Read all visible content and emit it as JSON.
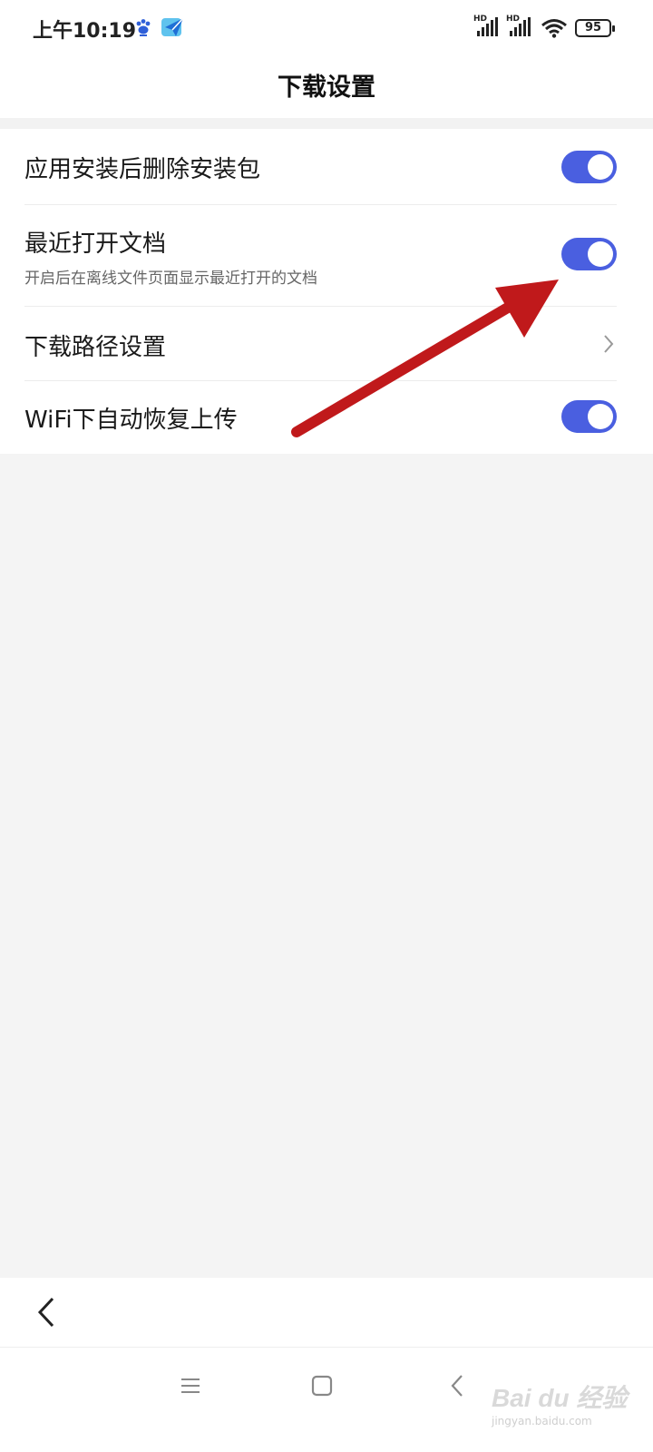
{
  "status_bar": {
    "time": "上午10:19",
    "signal_1_label": "HD",
    "signal_2_label": "HD",
    "battery_level": "95",
    "icons": [
      "baidu-paw-icon",
      "send-app-icon",
      "signal-icon",
      "signal-icon",
      "wifi-icon",
      "battery-icon"
    ]
  },
  "header": {
    "title": "下载设置"
  },
  "settings": [
    {
      "label": "应用安装后删除安装包",
      "control": "toggle",
      "on": true
    },
    {
      "label": "最近打开文档",
      "sublabel": "开启后在离线文件页面显示最近打开的文档",
      "control": "toggle",
      "on": true
    },
    {
      "label": "下载路径设置",
      "control": "chevron-right-icon"
    },
    {
      "label": "WiFi下自动恢复上传",
      "control": "toggle",
      "on": true
    }
  ],
  "colors": {
    "toggle_on": "#4a5fe0",
    "annotation_arrow": "#c0191b",
    "page_background": "#f4f4f4"
  },
  "bottom_nav": {
    "back_icon": "chevron-left-icon"
  },
  "system_nav": {
    "icons": [
      "menu-icon",
      "home-square-icon",
      "back-triangle-icon"
    ]
  },
  "watermark": {
    "text": "Bai du 经验",
    "url": "jingyan.baidu.com"
  }
}
